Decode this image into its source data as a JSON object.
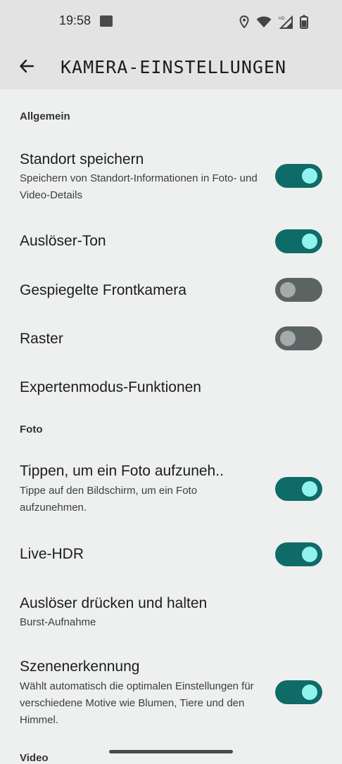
{
  "status_bar": {
    "time": "19:58",
    "notification_icon": "app-notification-icon",
    "icons": [
      "location-icon",
      "wifi-icon",
      "signal-hd-icon",
      "battery-icon"
    ]
  },
  "app_bar": {
    "back_icon": "arrow-back-icon",
    "title": "KAMERA-EINSTELLUNGEN"
  },
  "sections": {
    "allgemein": "Allgemein",
    "foto": "Foto",
    "video": "Video"
  },
  "settings": {
    "standort": {
      "title": "Standort speichern",
      "subtitle": "Speichern von Standort-Informationen in Foto- und Video-Details",
      "enabled": true
    },
    "ausloeser_ton": {
      "title": "Auslöser-Ton",
      "enabled": true
    },
    "gespiegelte": {
      "title": "Gespiegelte Frontkamera",
      "enabled": false
    },
    "raster": {
      "title": "Raster",
      "enabled": false
    },
    "expertenmodus": {
      "title": "Expertenmodus-Funktionen"
    },
    "tippen": {
      "title": "Tippen, um ein Foto aufzuneh..",
      "subtitle": "Tippe auf den Bildschirm, um ein Foto aufzunehmen.",
      "enabled": true
    },
    "live_hdr": {
      "title": "Live-HDR",
      "enabled": true
    },
    "ausloeser_halten": {
      "title": "Auslöser drücken und halten",
      "subtitle": "Burst-Aufnahme"
    },
    "szenenerkennung": {
      "title": "Szenenerkennung",
      "subtitle": "Wählt automatisch die optimalen Einstellungen für verschiedene Motive wie Blumen, Tiere und den Himmel.",
      "enabled": true
    }
  },
  "colors": {
    "toggle_on_track": "#0f6b68",
    "toggle_on_knob": "#92f3ee",
    "toggle_off_track": "#5c6363",
    "toggle_off_knob": "#a4abaa",
    "background": "#eef0ef",
    "bar_background": "#e3e3e3"
  }
}
